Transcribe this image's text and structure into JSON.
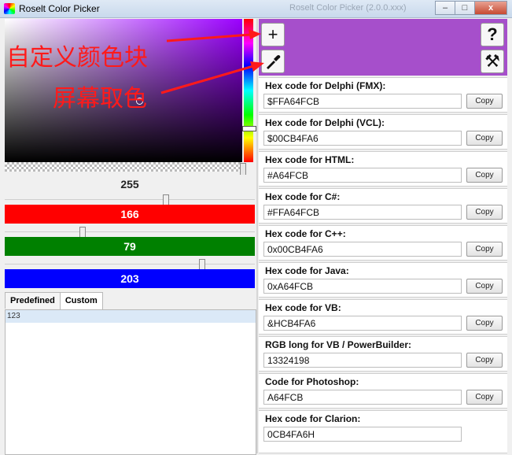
{
  "window": {
    "title": "Roselt Color Picker",
    "background_title": "Roselt Color Picker (2.0.0.xxx)",
    "controls": {
      "minimize": "–",
      "maximize": "□",
      "close": "x"
    }
  },
  "picker": {
    "alpha_value": "255",
    "red_value": "166",
    "green_value": "79",
    "blue_value": "203"
  },
  "tabs": [
    "Predefined",
    "Custom"
  ],
  "custom_list": [
    "123"
  ],
  "colors": {
    "current": "#A64FCB"
  },
  "tools": {
    "add_icon": "+",
    "help_icon": "?",
    "picker_icon": "eyedropper-icon",
    "settings_icon": "tools-icon",
    "settings_glyph": "⚒"
  },
  "codes": [
    {
      "label": "Hex code for Delphi (FMX):",
      "value": "$FFA64FCB",
      "button": "Copy"
    },
    {
      "label": "Hex code for Delphi (VCL):",
      "value": "$00CB4FA6",
      "button": "Copy"
    },
    {
      "label": "Hex code for HTML:",
      "value": "#A64FCB",
      "button": "Copy"
    },
    {
      "label": "Hex code for C#:",
      "value": "#FFA64FCB",
      "button": "Copy"
    },
    {
      "label": "Hex code for C++:",
      "value": "0x00CB4FA6",
      "button": "Copy"
    },
    {
      "label": "Hex code for Java:",
      "value": "0xA64FCB",
      "button": "Copy"
    },
    {
      "label": "Hex code for VB:",
      "value": "&HCB4FA6",
      "button": "Copy"
    },
    {
      "label": "RGB long for VB / PowerBuilder:",
      "value": "13324198",
      "button": "Copy"
    },
    {
      "label": "Code for Photoshop:",
      "value": "A64FCB",
      "button": "Copy"
    },
    {
      "label": "Hex code for Clarion:",
      "value": "0CB4FA6H",
      "button": ""
    }
  ],
  "annotations": {
    "custom_block": "自定义颜色块",
    "screen_pick": "屏幕取色"
  }
}
